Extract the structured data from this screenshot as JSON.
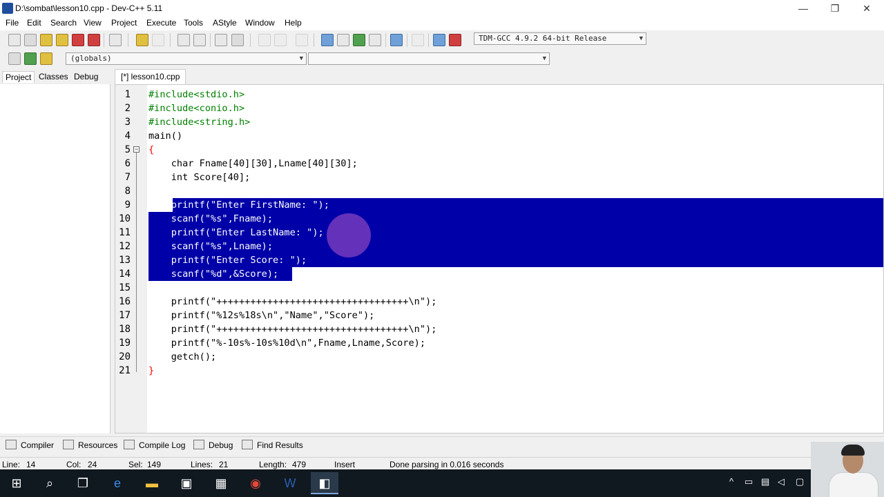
{
  "window": {
    "title": "D:\\sombat\\lesson10.cpp - Dev-C++ 5.11",
    "minimize": "—",
    "restore": "❐",
    "close": "✕"
  },
  "menu": [
    "File",
    "Edit",
    "Search",
    "View",
    "Project",
    "Execute",
    "Tools",
    "AStyle",
    "Window",
    "Help"
  ],
  "toolbar": {
    "compiler_select": "TDM-GCC 4.9.2 64-bit Release",
    "scope_select": "(globals)",
    "member_select": ""
  },
  "left_tabs": [
    "Project",
    "Classes",
    "Debug"
  ],
  "editor_tab": "[*] lesson10.cpp",
  "code": {
    "lines": [
      {
        "n": "1",
        "text": "#include<stdio.h>"
      },
      {
        "n": "2",
        "text": "#include<conio.h>"
      },
      {
        "n": "3",
        "text": "#include<string.h>"
      },
      {
        "n": "4",
        "text": "main()"
      },
      {
        "n": "5",
        "text": "{"
      },
      {
        "n": "6",
        "text": "    char Fname[40][30],Lname[40][30];"
      },
      {
        "n": "7",
        "text": "    int Score[40];"
      },
      {
        "n": "8",
        "text": ""
      },
      {
        "n": "9",
        "text": "    printf(\"Enter FirstName: \");"
      },
      {
        "n": "10",
        "text": "    scanf(\"%s\",Fname);"
      },
      {
        "n": "11",
        "text": "    printf(\"Enter LastName: \");"
      },
      {
        "n": "12",
        "text": "    scanf(\"%s\",Lname);"
      },
      {
        "n": "13",
        "text": "    printf(\"Enter Score: \");"
      },
      {
        "n": "14",
        "text": "    scanf(\"%d\",&Score);"
      },
      {
        "n": "15",
        "text": ""
      },
      {
        "n": "16",
        "text": "    printf(\"++++++++++++++++++++++++++++++++++\\n\");"
      },
      {
        "n": "17",
        "text": "    printf(\"%12s%18s\\n\",\"Name\",\"Score\");"
      },
      {
        "n": "18",
        "text": "    printf(\"++++++++++++++++++++++++++++++++++\\n\");"
      },
      {
        "n": "19",
        "text": "    printf(\"%-10s%-10s%10d\\n\",Fname,Lname,Score);"
      },
      {
        "n": "20",
        "text": "    getch();"
      },
      {
        "n": "21",
        "text": "}"
      }
    ]
  },
  "bottom_tabs": [
    "Compiler",
    "Resources",
    "Compile Log",
    "Debug",
    "Find Results"
  ],
  "status": {
    "line_label": "Line:",
    "line": "14",
    "col_label": "Col:",
    "col": "24",
    "sel_label": "Sel:",
    "sel": "149",
    "lines_label": "Lines:",
    "lines": "21",
    "length_label": "Length:",
    "length": "479",
    "mode": "Insert",
    "message": "Done parsing in 0.016 seconds"
  },
  "colors": {
    "selection": "#0000a8",
    "preprocessor": "#008000",
    "string": "#0000ff",
    "bracket": "#ff0000",
    "number": "#800080"
  }
}
